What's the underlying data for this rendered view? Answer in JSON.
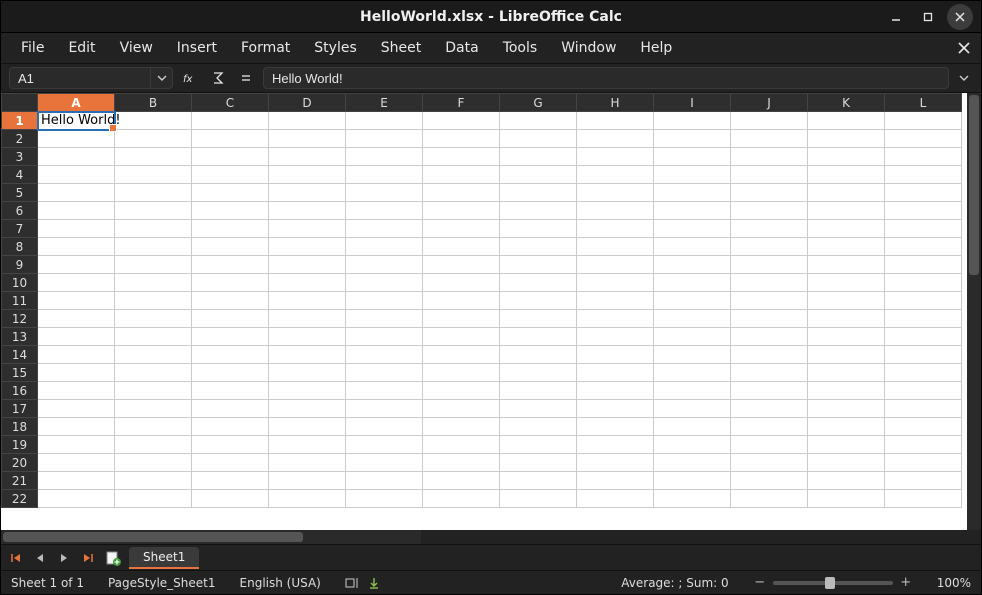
{
  "window": {
    "title": "HelloWorld.xlsx - LibreOffice Calc"
  },
  "menu": {
    "items": [
      "File",
      "Edit",
      "View",
      "Insert",
      "Format",
      "Styles",
      "Sheet",
      "Data",
      "Tools",
      "Window",
      "Help"
    ]
  },
  "formula_bar": {
    "name_box_value": "A1",
    "formula_value": "Hello World!"
  },
  "grid": {
    "columns": [
      "A",
      "B",
      "C",
      "D",
      "E",
      "F",
      "G",
      "H",
      "I",
      "J",
      "K",
      "L"
    ],
    "row_count": 22,
    "active_col": "A",
    "active_row": 1,
    "cells": {
      "A1": "Hello World!"
    }
  },
  "tabs": {
    "active": "Sheet1"
  },
  "statusbar": {
    "sheet_pos": "Sheet 1 of 1",
    "page_style": "PageStyle_Sheet1",
    "language": "English (USA)",
    "summary": "Average: ; Sum: 0",
    "zoom": "100%"
  }
}
